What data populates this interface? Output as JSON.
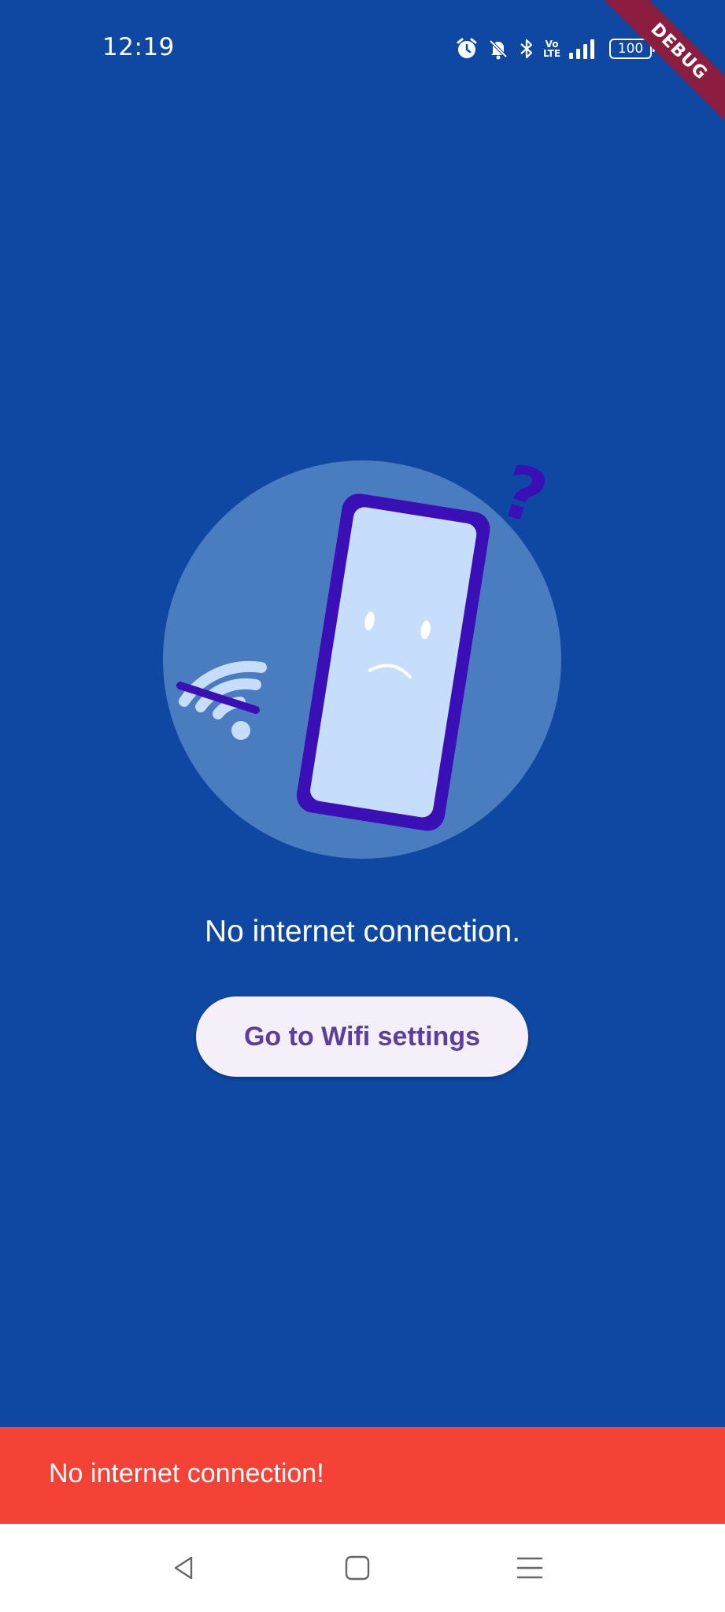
{
  "status_bar": {
    "time": "12:19",
    "icons": [
      "alarm-icon",
      "mute-icon",
      "bluetooth-icon",
      "volte-icon",
      "signal-icon",
      "battery-icon"
    ],
    "volte_top": "Vo",
    "volte_bottom": "LTE",
    "battery_level": "100"
  },
  "debug_banner": "DEBUG",
  "illustration": {
    "question_mark": "?",
    "colors": {
      "circle": "#4A7CC0",
      "phone_frame": "#3A0FB5",
      "phone_screen": "#C6DEFB",
      "wifi": "#C6DEFB"
    }
  },
  "main": {
    "message": "No internet connection.",
    "button_label": "Go to Wifi settings"
  },
  "snackbar": {
    "text": "No internet connection!",
    "color": "#F44336"
  },
  "nav_bar": {
    "buttons": [
      "back-icon",
      "home-icon",
      "menu-icon"
    ]
  },
  "colors": {
    "background": "#0E48A2",
    "button_bg": "#F4EFF8",
    "button_text": "#5B3F9A"
  }
}
